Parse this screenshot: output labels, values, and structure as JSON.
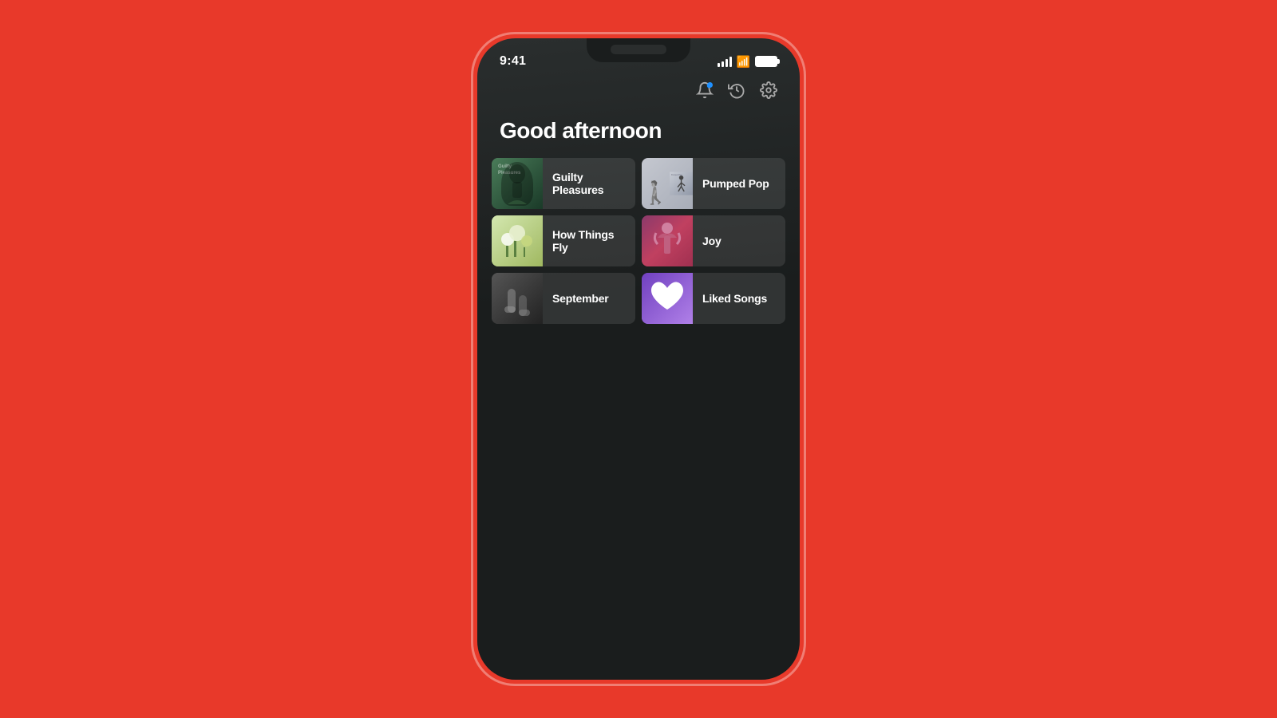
{
  "background_color": "#e8392a",
  "phone": {
    "status_bar": {
      "time": "9:41"
    },
    "app_icons": {
      "bell_label": "🔔",
      "history_label": "🕐",
      "settings_label": "⚙"
    },
    "greeting": "Good afternoon",
    "playlists": [
      {
        "id": "guilty-pleasures",
        "label": "Guilty Pleasures",
        "thumb_type": "guilty",
        "color_start": "#4a7c59",
        "color_end": "#1a3a28"
      },
      {
        "id": "pumped-pop",
        "label": "Pumped Pop",
        "thumb_type": "pumped",
        "color_start": "#c5c8d0",
        "color_end": "#9098a8"
      },
      {
        "id": "how-things-fly",
        "label": "How Things Fly",
        "thumb_type": "howthings",
        "color_start": "#d4e8b0",
        "color_end": "#a8c070"
      },
      {
        "id": "joy",
        "label": "Joy",
        "thumb_type": "joy",
        "color_start": "#8b3a6b",
        "color_end": "#a03050"
      },
      {
        "id": "september",
        "label": "September",
        "thumb_type": "september",
        "color_start": "#555555",
        "color_end": "#333333"
      },
      {
        "id": "liked-songs",
        "label": "Liked Songs",
        "thumb_type": "liked",
        "color_start": "#8040c0",
        "color_end": "#a070e0"
      }
    ]
  }
}
